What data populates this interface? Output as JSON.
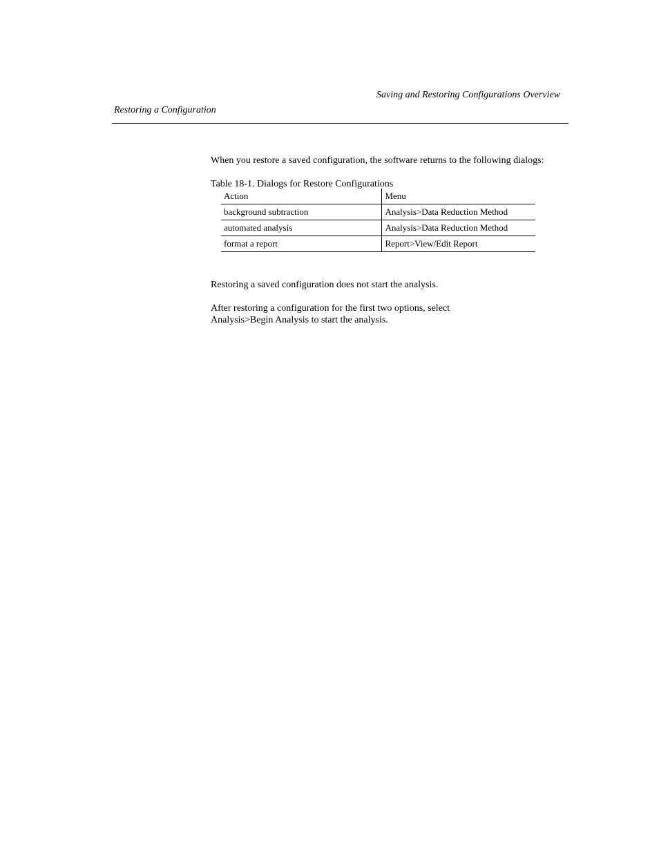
{
  "header": {
    "right": "Saving and Restoring Configurations Overview",
    "left": "Restoring a Configuration"
  },
  "body": {
    "intro1": "When you restore a saved configuration, the software returns to the following dialogs:",
    "intro2": "Table 18-1. Dialogs for Restore Configurations",
    "note1": "Restoring a saved configuration does not start the analysis.",
    "note2": "After restoring a configuration for the first two options, select",
    "note3": "Analysis>Begin Analysis to start the analysis."
  },
  "table": {
    "header": {
      "action": "Action",
      "menu": "Menu"
    },
    "rows": [
      {
        "action": "background subtraction",
        "menu": "Analysis>Data Reduction Method"
      },
      {
        "action": "automated analysis",
        "menu": "Analysis>Data Reduction Method"
      },
      {
        "action": "format a report",
        "menu": "Report>View/Edit Report"
      }
    ]
  }
}
